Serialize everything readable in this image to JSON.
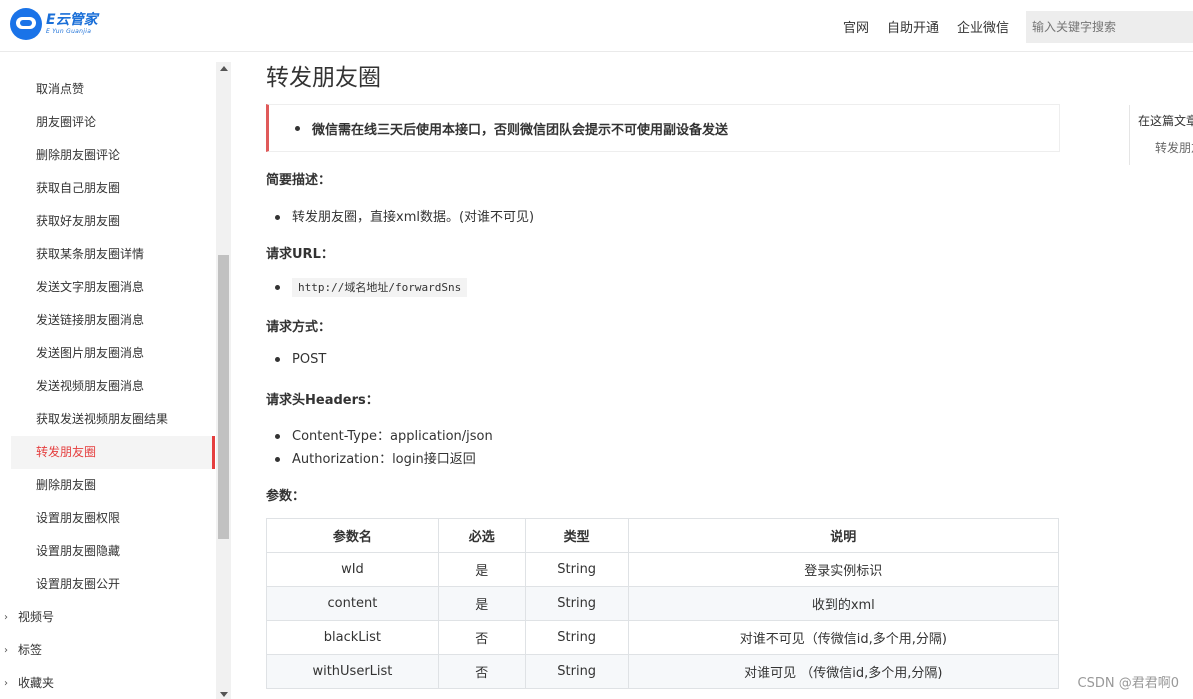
{
  "header": {
    "logo_name": "E云管家",
    "logo_sub": "E Yun Guanjia",
    "nav": [
      "官网",
      "自助开通",
      "企业微信"
    ],
    "search_placeholder": "输入关键字搜索"
  },
  "sidebar": {
    "items": [
      {
        "label": "取消点赞"
      },
      {
        "label": "朋友圈评论"
      },
      {
        "label": "删除朋友圈评论"
      },
      {
        "label": "获取自己朋友圈"
      },
      {
        "label": "获取好友朋友圈"
      },
      {
        "label": "获取某条朋友圈详情"
      },
      {
        "label": "发送文字朋友圈消息"
      },
      {
        "label": "发送链接朋友圈消息"
      },
      {
        "label": "发送图片朋友圈消息"
      },
      {
        "label": "发送视频朋友圈消息"
      },
      {
        "label": "获取发送视频朋友圈结果"
      },
      {
        "label": "转发朋友圈",
        "active": true
      },
      {
        "label": "删除朋友圈"
      },
      {
        "label": "设置朋友圈权限"
      },
      {
        "label": "设置朋友圈隐藏"
      },
      {
        "label": "设置朋友圈公开"
      }
    ],
    "groups": [
      "视频号",
      "标签",
      "收藏夹"
    ]
  },
  "main": {
    "title": "转发朋友圈",
    "notice": "微信需在线三天后使用本接口，否则微信团队会提示不可使用副设备发送",
    "desc_heading": "简要描述：",
    "desc_item": "转发朋友圈，直接xml数据。(对谁不可见)",
    "url_heading": "请求URL：",
    "url_value": "http://域名地址/forwardSns",
    "method_heading": "请求方式：",
    "method_value": "POST",
    "headers_heading": "请求头Headers：",
    "headers_items": [
      "Content-Type：application/json",
      "Authorization：login接口返回"
    ],
    "params_heading": "参数：",
    "table": {
      "columns": [
        "参数名",
        "必选",
        "类型",
        "说明"
      ],
      "rows": [
        [
          "wId",
          "是",
          "String",
          "登录实例标识"
        ],
        [
          "content",
          "是",
          "String",
          "收到的xml"
        ],
        [
          "blackList",
          "否",
          "String",
          "对谁不可见（传微信id,多个用,分隔)"
        ],
        [
          "withUserList",
          "否",
          "String",
          "对谁可见 （传微信id,多个用,分隔)"
        ]
      ]
    }
  },
  "toc": {
    "title": "在这篇文章中",
    "item": "转发朋友圈"
  },
  "watermark": "CSDN @君君啊0"
}
